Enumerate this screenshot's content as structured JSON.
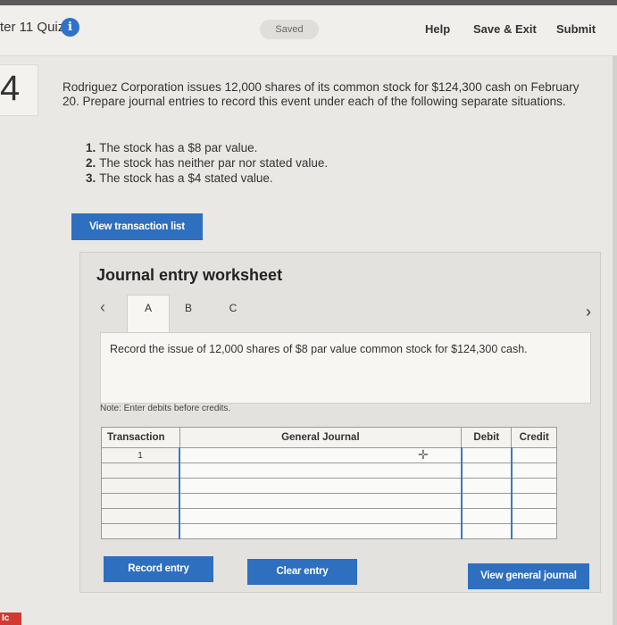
{
  "header": {
    "quiz_title": "ter 11 Quiz",
    "info_icon": "info-icon",
    "saved_label": "Saved",
    "help_label": "Help",
    "save_exit_label": "Save & Exit",
    "submit_label": "Submit"
  },
  "question": {
    "number": "4",
    "text": "Rodriguez Corporation issues 12,000 shares of its common stock for $124,300 cash on February 20. Prepare journal entries to record this event under each of the following separate situations.",
    "situations": [
      {
        "num": "1.",
        "text": "The stock has a $8 par value."
      },
      {
        "num": "2.",
        "text": "The stock has neither par nor stated value."
      },
      {
        "num": "3.",
        "text": "The stock has a $4 stated value."
      }
    ],
    "view_transactions_label": "View transaction list"
  },
  "worksheet": {
    "title": "Journal entry worksheet",
    "tabs": [
      "A",
      "B",
      "C"
    ],
    "description": "Record the issue of 12,000 shares of $8 par value common stock for $124,300 cash.",
    "note": "Note: Enter debits before credits.",
    "columns": {
      "transaction": "Transaction",
      "general_journal": "General Journal",
      "debit": "Debit",
      "credit": "Credit"
    },
    "rows": [
      {
        "transaction": "1"
      },
      {
        "transaction": ""
      },
      {
        "transaction": ""
      },
      {
        "transaction": ""
      },
      {
        "transaction": ""
      },
      {
        "transaction": ""
      }
    ],
    "record_entry_label": "Record entry",
    "clear_entry_label": "Clear entry",
    "view_general_journal_label": "View general journal"
  },
  "footer": {
    "badge_text": "Ic"
  },
  "colors": {
    "accent_blue": "#2e6fbf",
    "info_blue": "#2f73c9",
    "badge_red": "#d23a2f"
  }
}
